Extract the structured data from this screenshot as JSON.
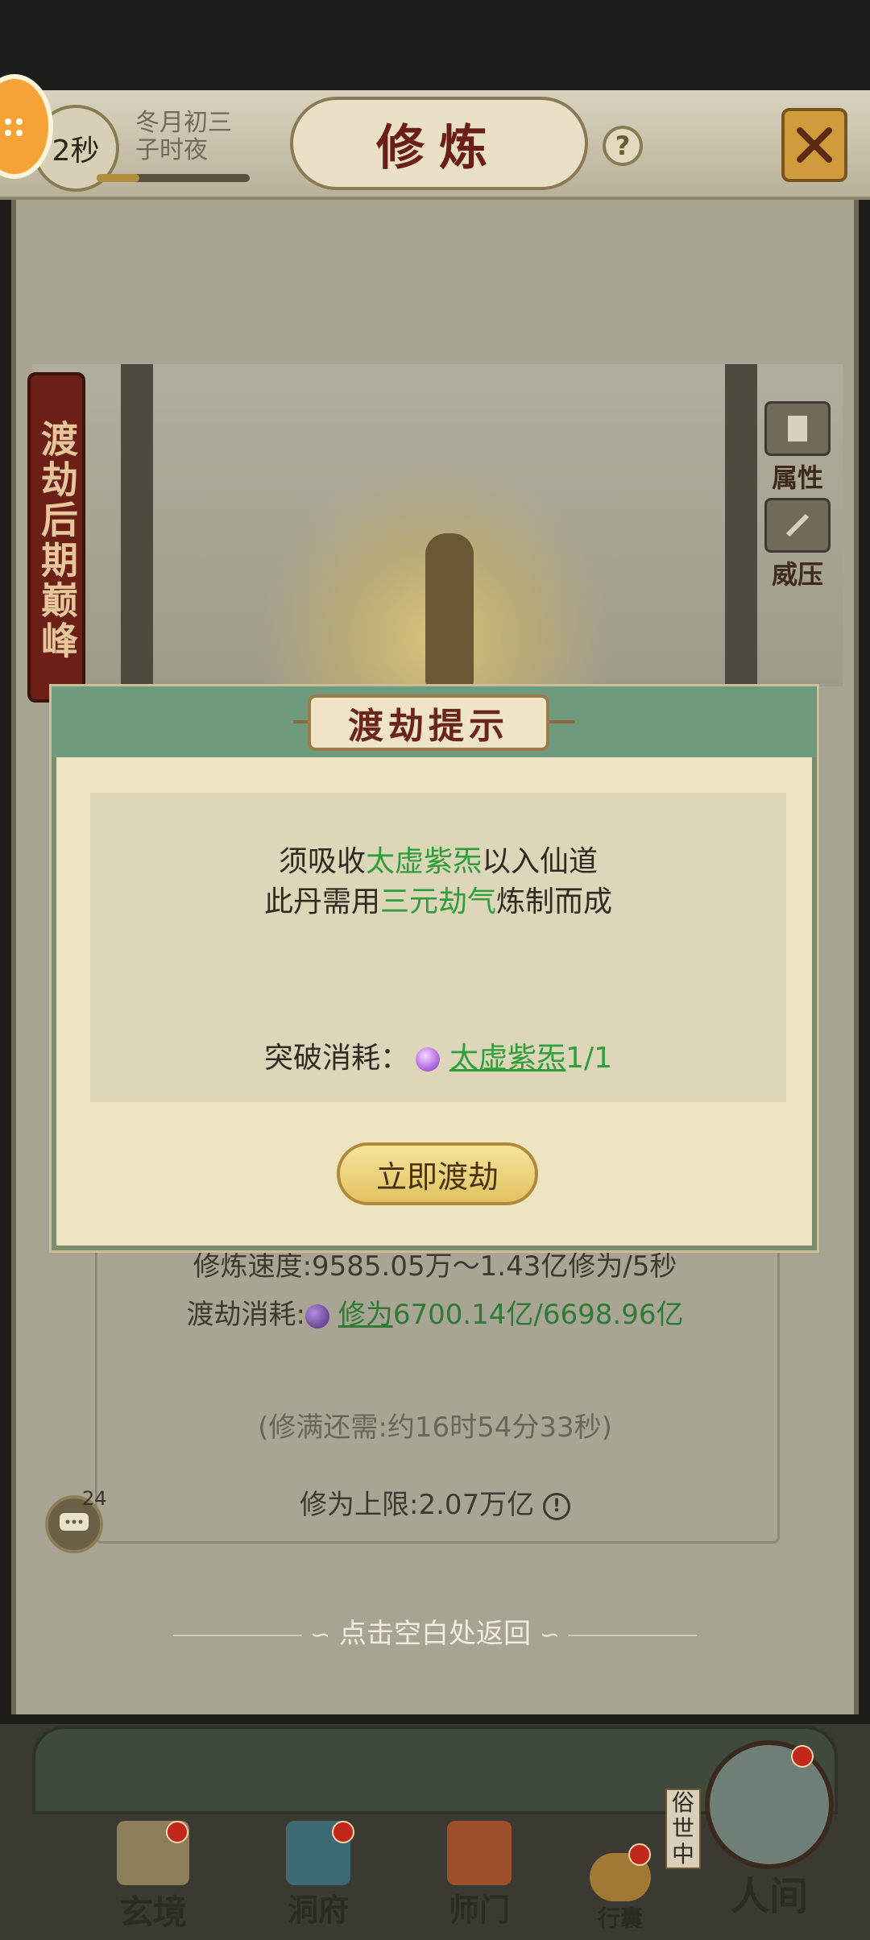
{
  "header": {
    "timer": "2秒",
    "date_line1": "冬月初三",
    "date_line2": "子时夜",
    "title": "修炼",
    "help_symbol": "?",
    "progress_fraction": 0.28
  },
  "scene": {
    "realm_label": "渡劫后期巅峰",
    "side_buttons": [
      {
        "label": "属性"
      },
      {
        "label": "威压"
      }
    ]
  },
  "info": {
    "speed_line": "修炼速度:9585.05万～1.43亿修为/5秒",
    "cost_label": "渡劫消耗:",
    "cost_item": "修为",
    "cost_value": "6700.14亿/6698.96亿",
    "remaining": "(修满还需:约16时54分33秒)",
    "cap_label": "修为上限:2.07万亿",
    "chat_badge": "24"
  },
  "tap_hint": "点击空白处返回",
  "modal": {
    "title": "渡劫提示",
    "line1_prefix": "须吸收",
    "line1_highlight": "太虚紫炁",
    "line1_suffix": "以入仙道",
    "line2_prefix": "此丹需用",
    "line2_highlight": "三元劫气",
    "line2_suffix": "炼制而成",
    "cost_label": "突破消耗：",
    "cost_item": "太虚紫炁",
    "cost_count": "1/1",
    "button": "立即渡劫"
  },
  "bottom_nav": {
    "items": [
      {
        "label": "玄境"
      },
      {
        "label": "洞府"
      },
      {
        "label": "师门"
      },
      {
        "label": "行囊"
      },
      {
        "label": "人间"
      }
    ],
    "side_tag": "俗世中"
  },
  "colors": {
    "highlight_green": "#2f9f3c",
    "title_red": "#6a2418",
    "modal_header_green": "#6f9a7e"
  }
}
